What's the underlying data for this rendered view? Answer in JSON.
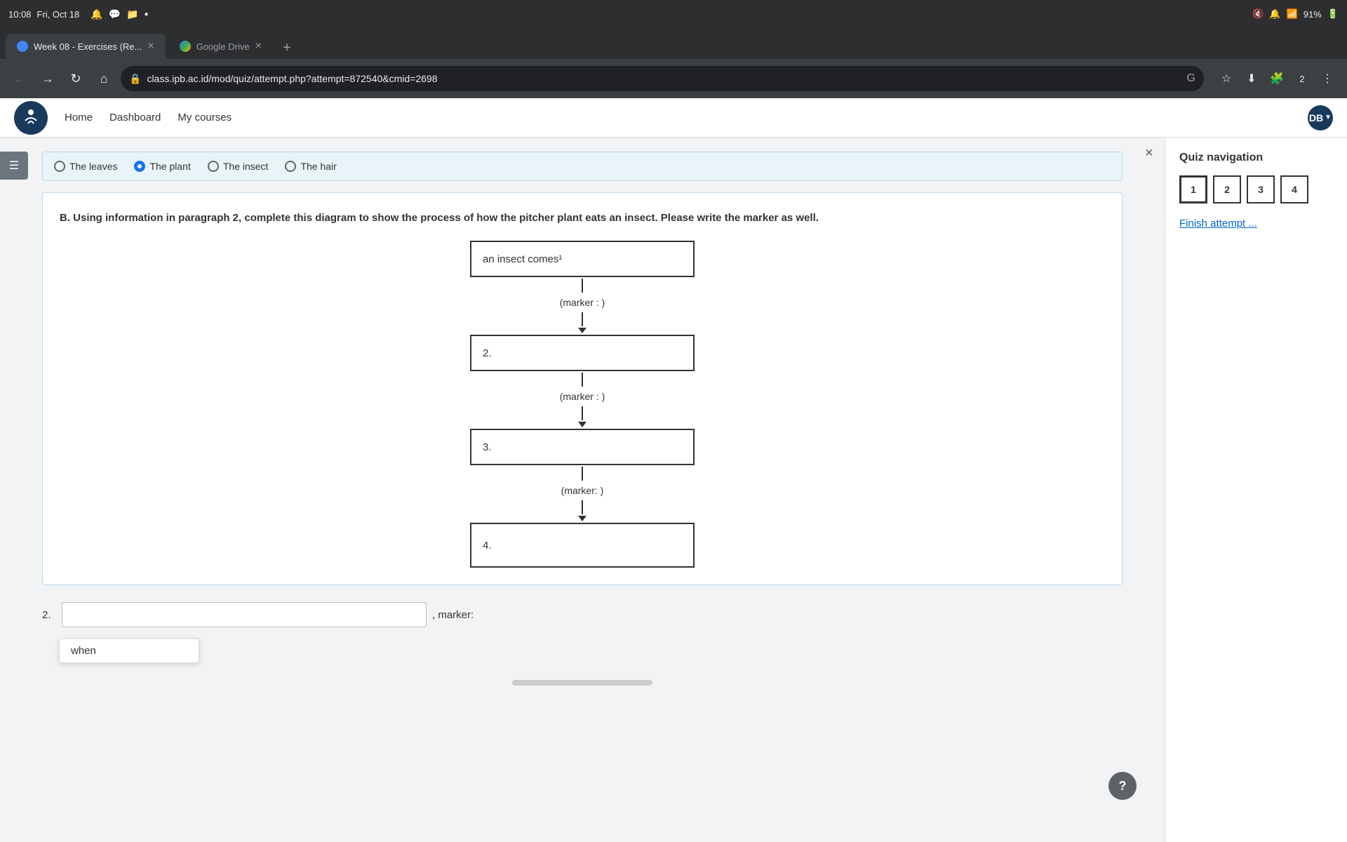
{
  "titlebar": {
    "time": "10:08",
    "date": "Fri, Oct 18",
    "battery": "91%"
  },
  "tabs": [
    {
      "id": "tab1",
      "title": "Week 08 - Exercises (Re...",
      "favicon_color": "#4285f4",
      "active": true
    },
    {
      "id": "tab2",
      "title": "Google Drive",
      "favicon_color": "#4285f4",
      "active": false
    }
  ],
  "addressbar": {
    "url": "class.ipb.ac.id/mod/quiz/attempt.php?attempt=872540&cmid=2698"
  },
  "nav": {
    "home": "Home",
    "dashboard": "Dashboard",
    "mycourses": "My courses",
    "user_initials": "DB"
  },
  "question_b": {
    "label": "B.",
    "text": "Using information in paragraph 2, complete this diagram to show the process of how the pitcher plant eats an insect. Please write the marker as well.",
    "diagram": {
      "box1": "an insect  comes¹",
      "marker1": "(marker :                                    )",
      "box2_label": "2.",
      "marker2": "(marker :                                    )",
      "box3_label": "3.",
      "marker3": "(marker:                                   )",
      "box4_label": "4."
    }
  },
  "answer_row": {
    "number": "2.",
    "placeholder": "",
    "label": ", marker:"
  },
  "autocomplete": {
    "suggestion": "when"
  },
  "quiz_navigation": {
    "title": "Quiz navigation",
    "numbers": [
      "1",
      "2",
      "3",
      "4"
    ],
    "active_number": "1",
    "finish_link": "Finish attempt ..."
  },
  "radio_options": [
    {
      "label": "The leaves",
      "selected": false
    },
    {
      "label": "The plant",
      "selected": true
    },
    {
      "label": "The insect",
      "selected": false
    },
    {
      "label": "The hair",
      "selected": false
    }
  ],
  "help_btn_label": "?",
  "close_btn": "×"
}
